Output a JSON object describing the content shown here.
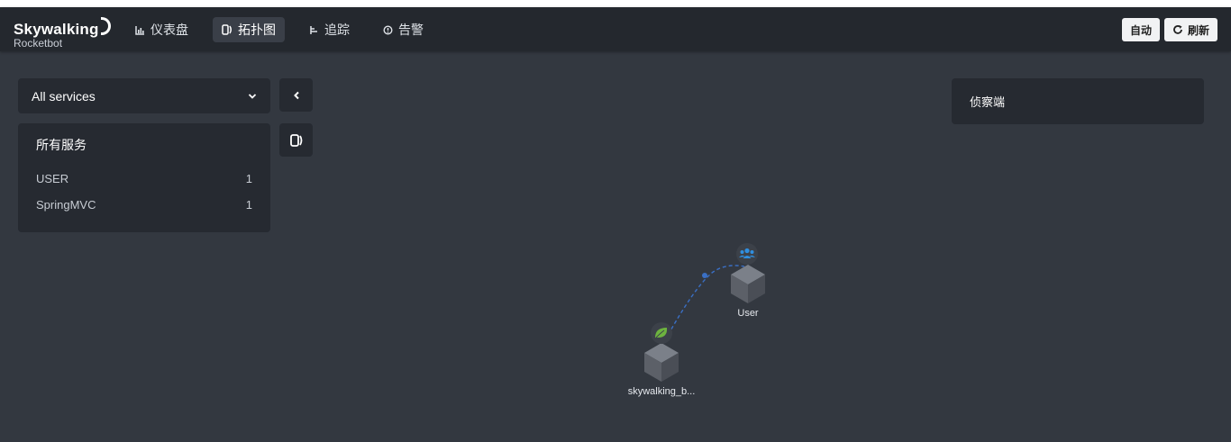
{
  "header": {
    "logo": "Skywalking",
    "logo_sub": "Rocketbot",
    "nav": [
      {
        "label": "仪表盘",
        "icon": "bar-chart-icon"
      },
      {
        "label": "拓扑图",
        "icon": "topology-icon"
      },
      {
        "label": "追踪",
        "icon": "trace-icon"
      },
      {
        "label": "告警",
        "icon": "alarm-icon"
      }
    ],
    "auto_label": "自动",
    "refresh_label": "刷新"
  },
  "sidebar": {
    "select_value": "All services",
    "panel_title": "所有服务",
    "services": [
      {
        "name": "USER",
        "count": "1"
      },
      {
        "name": "SpringMVC",
        "count": "1"
      }
    ]
  },
  "detector": {
    "title": "侦察端"
  },
  "topology": {
    "nodes": [
      {
        "name": "User",
        "type": "user"
      },
      {
        "name": "skywalking_b...",
        "type": "springmvc"
      }
    ],
    "colors": {
      "link": "#3a6fc4",
      "spring": "#6db33f",
      "user": "#2f8fe0",
      "cube_top": "#7b8089",
      "cube_left": "#5c6068",
      "cube_right": "#4a4e56"
    }
  }
}
